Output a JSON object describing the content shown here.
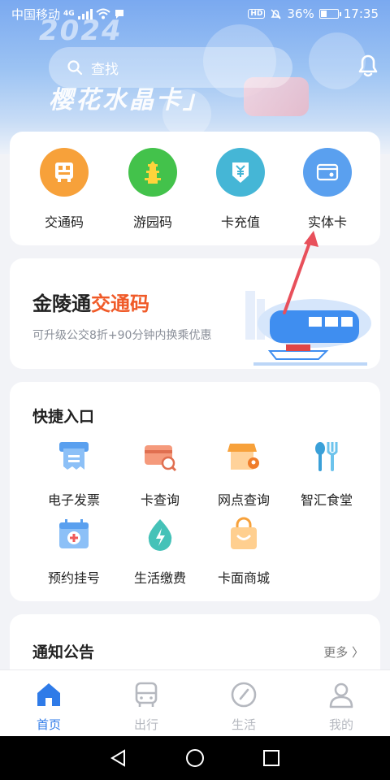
{
  "status_bar": {
    "carrier": "中国移动",
    "network": "4G",
    "battery": "36%",
    "time": "17:35"
  },
  "banner": {
    "year": "2024",
    "slogan": "樱花水晶卡」"
  },
  "search": {
    "placeholder": "查找"
  },
  "quick_actions": [
    {
      "label": "交通码",
      "icon": "bus-qr-icon",
      "color": "#f7a13a"
    },
    {
      "label": "游园码",
      "icon": "pagoda-icon",
      "color": "#43c24b"
    },
    {
      "label": "卡充值",
      "icon": "yen-recharge-icon",
      "color": "#45b6d6"
    },
    {
      "label": "实体卡",
      "icon": "physical-card-icon",
      "color": "#5aa0ef"
    }
  ],
  "promo": {
    "title_prefix": "金陵通",
    "title_highlight": "交通码",
    "subtitle": "可升级公交8折+90分钟内换乘优惠"
  },
  "shortcuts": {
    "title": "快捷入口",
    "items": [
      {
        "label": "电子发票",
        "icon": "invoice-icon"
      },
      {
        "label": "卡查询",
        "icon": "card-search-icon"
      },
      {
        "label": "网点查询",
        "icon": "store-location-icon"
      },
      {
        "label": "智汇食堂",
        "icon": "dining-icon"
      },
      {
        "label": "预约挂号",
        "icon": "medical-appointment-icon"
      },
      {
        "label": "生活缴费",
        "icon": "utility-bill-icon"
      },
      {
        "label": "卡面商城",
        "icon": "shopping-bag-icon"
      }
    ]
  },
  "notice": {
    "title": "通知公告",
    "more": "更多 〉"
  },
  "tabs": [
    {
      "label": "首页",
      "icon": "home-icon",
      "active": true
    },
    {
      "label": "出行",
      "icon": "bus-icon",
      "active": false
    },
    {
      "label": "生活",
      "icon": "compass-icon",
      "active": false
    },
    {
      "label": "我的",
      "icon": "profile-icon",
      "active": false
    }
  ],
  "colors": {
    "accent": "#2f7be8",
    "highlight": "#f05a28",
    "annotation_arrow": "#e8505b"
  }
}
